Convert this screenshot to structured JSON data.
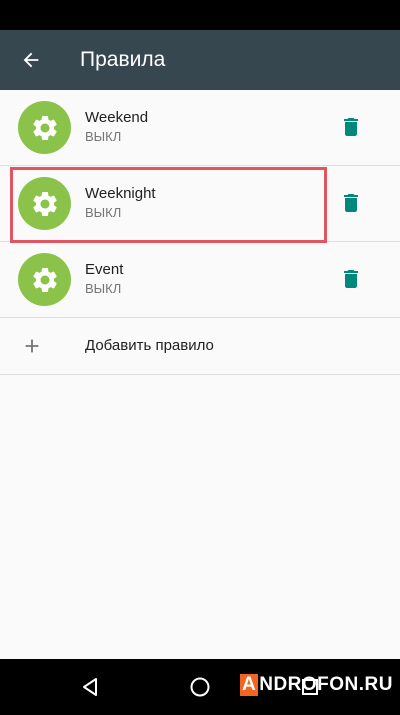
{
  "app_bar": {
    "title": "Правила"
  },
  "rules": [
    {
      "name": "Weekend",
      "status": "ВЫКЛ"
    },
    {
      "name": "Weeknight",
      "status": "ВЫКЛ"
    },
    {
      "name": "Event",
      "status": "ВЫКЛ"
    }
  ],
  "add_rule": {
    "label": "Добавить правило"
  },
  "watermark": {
    "first": "A",
    "rest": "NDROFON.RU"
  },
  "colors": {
    "app_bar": "#37474f",
    "gear_badge": "#8bc34a",
    "delete_icon": "#00897b",
    "highlight": "#e05560",
    "watermark_accent": "#f26522"
  },
  "icons": {
    "back": "arrow-back-icon",
    "rule": "gear-icon",
    "delete": "trash-icon",
    "add": "plus-icon"
  }
}
